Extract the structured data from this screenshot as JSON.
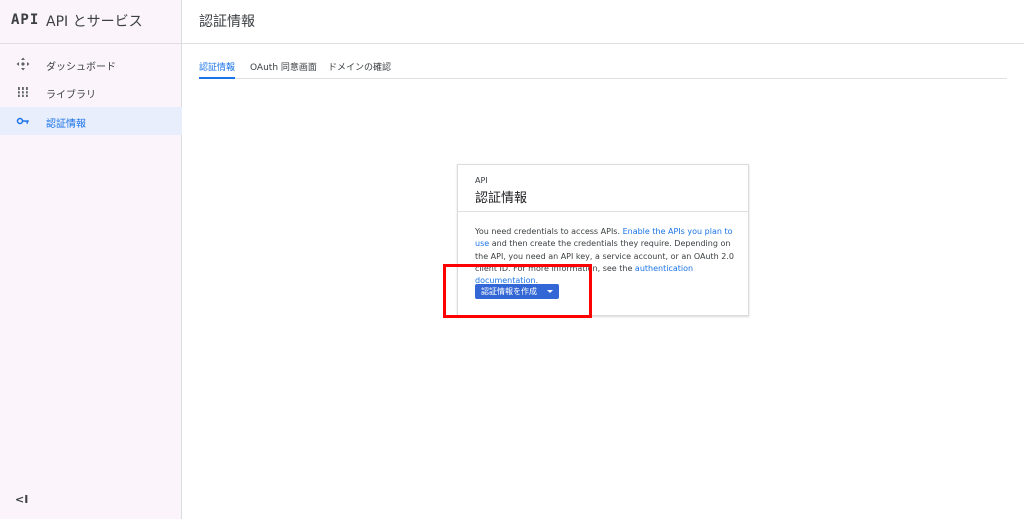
{
  "sidebar": {
    "logo": "API",
    "title": "API とサービス",
    "items": [
      {
        "label": "ダッシュボード",
        "icon": "dashboard-icon"
      },
      {
        "label": "ライブラリ",
        "icon": "library-icon"
      },
      {
        "label": "認証情報",
        "icon": "key-icon",
        "active": true
      }
    ],
    "collapse_label": "<I"
  },
  "header": {
    "title": "認証情報"
  },
  "tabs": [
    {
      "label": "認証情報",
      "active": true
    },
    {
      "label": "OAuth 同意画面"
    },
    {
      "label": "ドメインの確認"
    }
  ],
  "card": {
    "eyebrow": "API",
    "title": "認証情報",
    "body_1": "You need credentials to access APIs. ",
    "link_1": "Enable the APIs you plan to use",
    "body_2": " and then create the credentials they require. Depending on the API, you need an API key, a service account, or an OAuth 2.0 client ID. For more information, see the ",
    "link_2": "authentication documentation",
    "body_3": ".",
    "create_button": "認証情報を作成"
  },
  "colors": {
    "accent": "#1a73e8",
    "button": "#3367d6",
    "sidebar_bg": "#fbf4fb",
    "highlight": "#ff0000"
  }
}
